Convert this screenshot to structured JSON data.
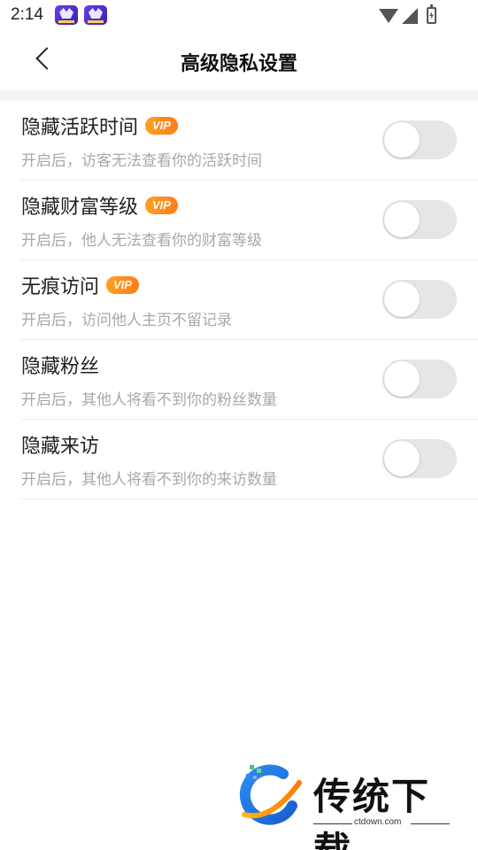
{
  "status_bar": {
    "time": "2:14",
    "icons": [
      "app-notification-icon",
      "app-notification-icon",
      "wifi-icon",
      "cell-signal-icon",
      "battery-charging-icon"
    ]
  },
  "header": {
    "title": "高级隐私设置",
    "back_icon": "chevron-left-icon"
  },
  "settings": [
    {
      "title": "隐藏活跃时间",
      "vip": true,
      "vip_label": "VIP",
      "description": "开启后，访客无法查看你的活跃时间",
      "enabled": false
    },
    {
      "title": "隐藏财富等级",
      "vip": true,
      "vip_label": "VIP",
      "description": "开启后，他人无法查看你的财富等级",
      "enabled": false
    },
    {
      "title": "无痕访问",
      "vip": true,
      "vip_label": "VIP",
      "description": "开启后，访问他人主页不留记录",
      "enabled": false
    },
    {
      "title": "隐藏粉丝",
      "vip": false,
      "description": "开启后，其他人将看不到你的粉丝数量",
      "enabled": false
    },
    {
      "title": "隐藏来访",
      "vip": false,
      "description": "开启后，其他人将看不到你的来访数量",
      "enabled": false
    }
  ],
  "watermark": {
    "brand": "传统下载",
    "url": "ctdown.com"
  },
  "colors": {
    "vip_badge": "#ff8a1e",
    "toggle_off": "#e6e6e6",
    "description_text": "#a8a8a8",
    "divider": "#f5f5f8"
  }
}
